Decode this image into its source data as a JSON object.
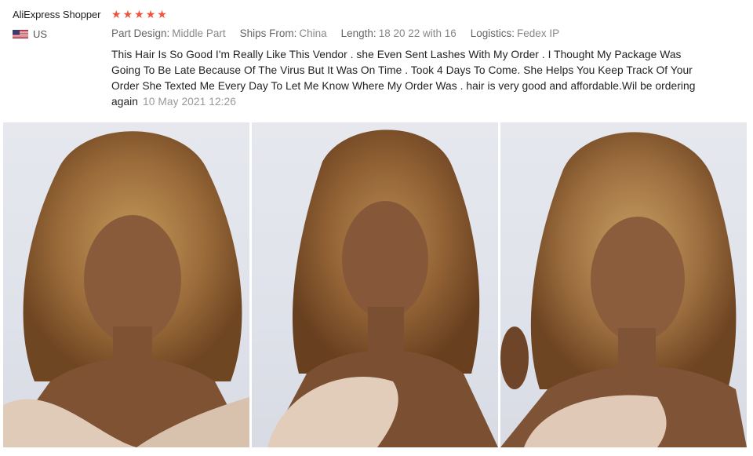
{
  "review": {
    "reviewer_name": "AliExpress Shopper",
    "rating": 5,
    "star_color": "#f2513b",
    "country_code": "US",
    "attributes": [
      {
        "label": "Part Design:",
        "value": "Middle Part"
      },
      {
        "label": "Ships From:",
        "value": "China"
      },
      {
        "label": "Length:",
        "value": "18 20 22 with 16"
      },
      {
        "label": "Logistics:",
        "value": "Fedex IP"
      }
    ],
    "text": "This Hair Is So Good I'm Really Like This Vendor . she Even Sent Lashes With My Order . I Thought My Package Was Going To Be Late Because Of The Virus But It Was On Time . Took 4 Days To Come. She Helps You Keep Track Of Your Order She Texted Me Every Day To Let Me Know Where My Order Was . hair is very good and af­fordable.Wil be ordering again",
    "date": "10 May 2021 12:26"
  },
  "photos": [
    {
      "icon": "review-photo-1"
    },
    {
      "icon": "review-photo-2"
    },
    {
      "icon": "review-photo-3"
    }
  ]
}
